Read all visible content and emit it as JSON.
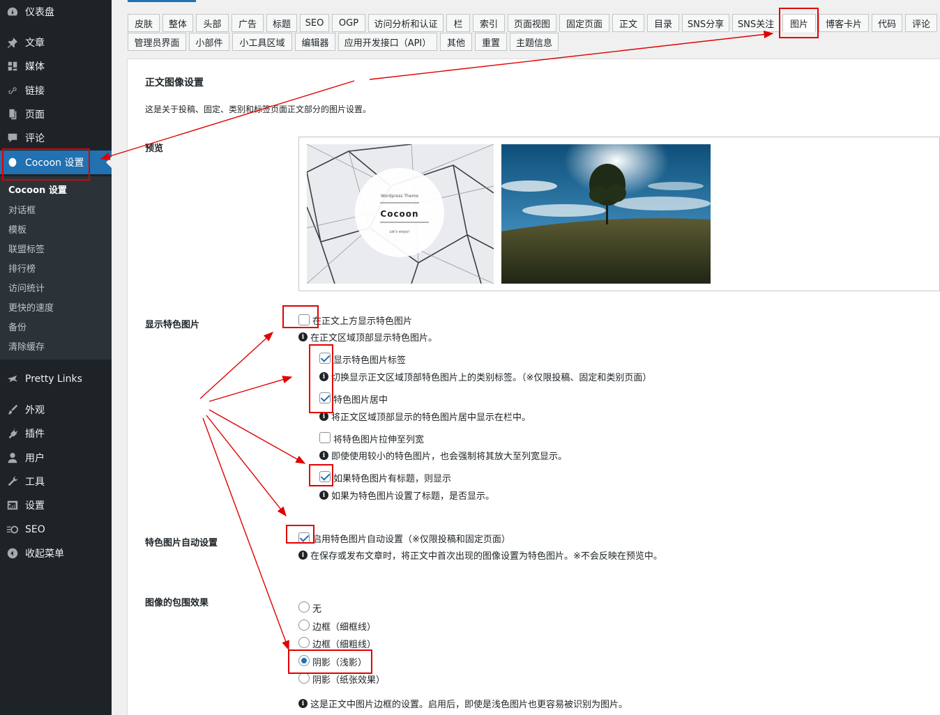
{
  "sidebar": {
    "items": [
      {
        "label": "仪表盘",
        "icon": "dashboard-icon"
      },
      {
        "label": "文章",
        "icon": "pin-icon"
      },
      {
        "label": "媒体",
        "icon": "media-icon"
      },
      {
        "label": "链接",
        "icon": "link-icon"
      },
      {
        "label": "页面",
        "icon": "page-icon"
      },
      {
        "label": "评论",
        "icon": "comment-icon"
      },
      {
        "label": "Cocoon 设置",
        "icon": "cocoon-icon",
        "current": true
      },
      {
        "label": "Pretty Links",
        "icon": "star-icon"
      },
      {
        "label": "外观",
        "icon": "brush-icon"
      },
      {
        "label": "插件",
        "icon": "plug-icon"
      },
      {
        "label": "用户",
        "icon": "user-icon"
      },
      {
        "label": "工具",
        "icon": "wrench-icon"
      },
      {
        "label": "设置",
        "icon": "settings-icon"
      },
      {
        "label": "SEO",
        "icon": "seo-icon"
      },
      {
        "label": "收起菜单",
        "icon": "collapse-icon"
      }
    ],
    "submenu": [
      "Cocoon 设置",
      "对话框",
      "模板",
      "联盟标签",
      "排行榜",
      "访问统计",
      "更快的速度",
      "备份",
      "清除缓存"
    ]
  },
  "tabs": {
    "row1": [
      "皮肤",
      "整体",
      "头部",
      "广告",
      "标题",
      "SEO",
      "OGP",
      "访问分析和认证",
      "栏",
      "索引",
      "页面视图",
      "固定页面",
      "正文",
      "目录",
      "SNS分享",
      "SNS关注",
      "图片",
      "博客卡片",
      "代码",
      "评论"
    ],
    "row2": [
      "管理员界面",
      "小部件",
      "小工具区域",
      "编辑器",
      "应用开发接口（API）",
      "其他",
      "重置",
      "主题信息"
    ],
    "active": "图片"
  },
  "section": {
    "title": "正文图像设置",
    "description": "这是关于投稿、固定、类别和标签页面正文部分的图片设置。"
  },
  "preview": {
    "label": "预览",
    "thumb_small_text": "Wordpress Theme",
    "thumb_title": "Cocoon",
    "thumb_sub_text": "Let's enjoy!"
  },
  "featured": {
    "label": "显示特色图片",
    "options": [
      {
        "label": "在正文上方显示特色图片",
        "checked": false,
        "info": "在正文区域顶部显示特色图片。"
      },
      {
        "label": "显示特色图片标签",
        "checked": true,
        "info": "切换显示正文区域顶部特色图片上的类别标签。（※仅限投稿、固定和类别页面）"
      },
      {
        "label": "特色图片居中",
        "checked": true,
        "info": "将正文区域顶部显示的特色图片居中显示在栏中。"
      },
      {
        "label": "将特色图片拉伸至列宽",
        "checked": false,
        "info": "即使使用较小的特色图片，也会强制将其放大至列宽显示。"
      },
      {
        "label": "如果特色图片有标题，则显示",
        "checked": true,
        "info": "如果为特色图片设置了标题，是否显示。"
      }
    ]
  },
  "auto": {
    "label": "特色图片自动设置",
    "option": "启用特色图片自动设置（※仅限投稿和固定页面）",
    "checked": true,
    "info": "在保存或发布文章时，将正文中首次出现的图像设置为特色图片。※不会反映在预览中。"
  },
  "wrap": {
    "label": "图像的包围效果",
    "options": [
      "无",
      "边框（细框线）",
      "边框（细粗线）",
      "阴影（浅影）",
      "阴影（纸张效果）"
    ],
    "selected": "阴影（浅影）",
    "info": "这是正文中图片边框的设置。启用后，即使是浅色图片也更容易被识别为图片。"
  },
  "colors": {
    "sidebar_bg": "#1d2327",
    "accent": "#2271b1",
    "annotation": "#e00000"
  }
}
